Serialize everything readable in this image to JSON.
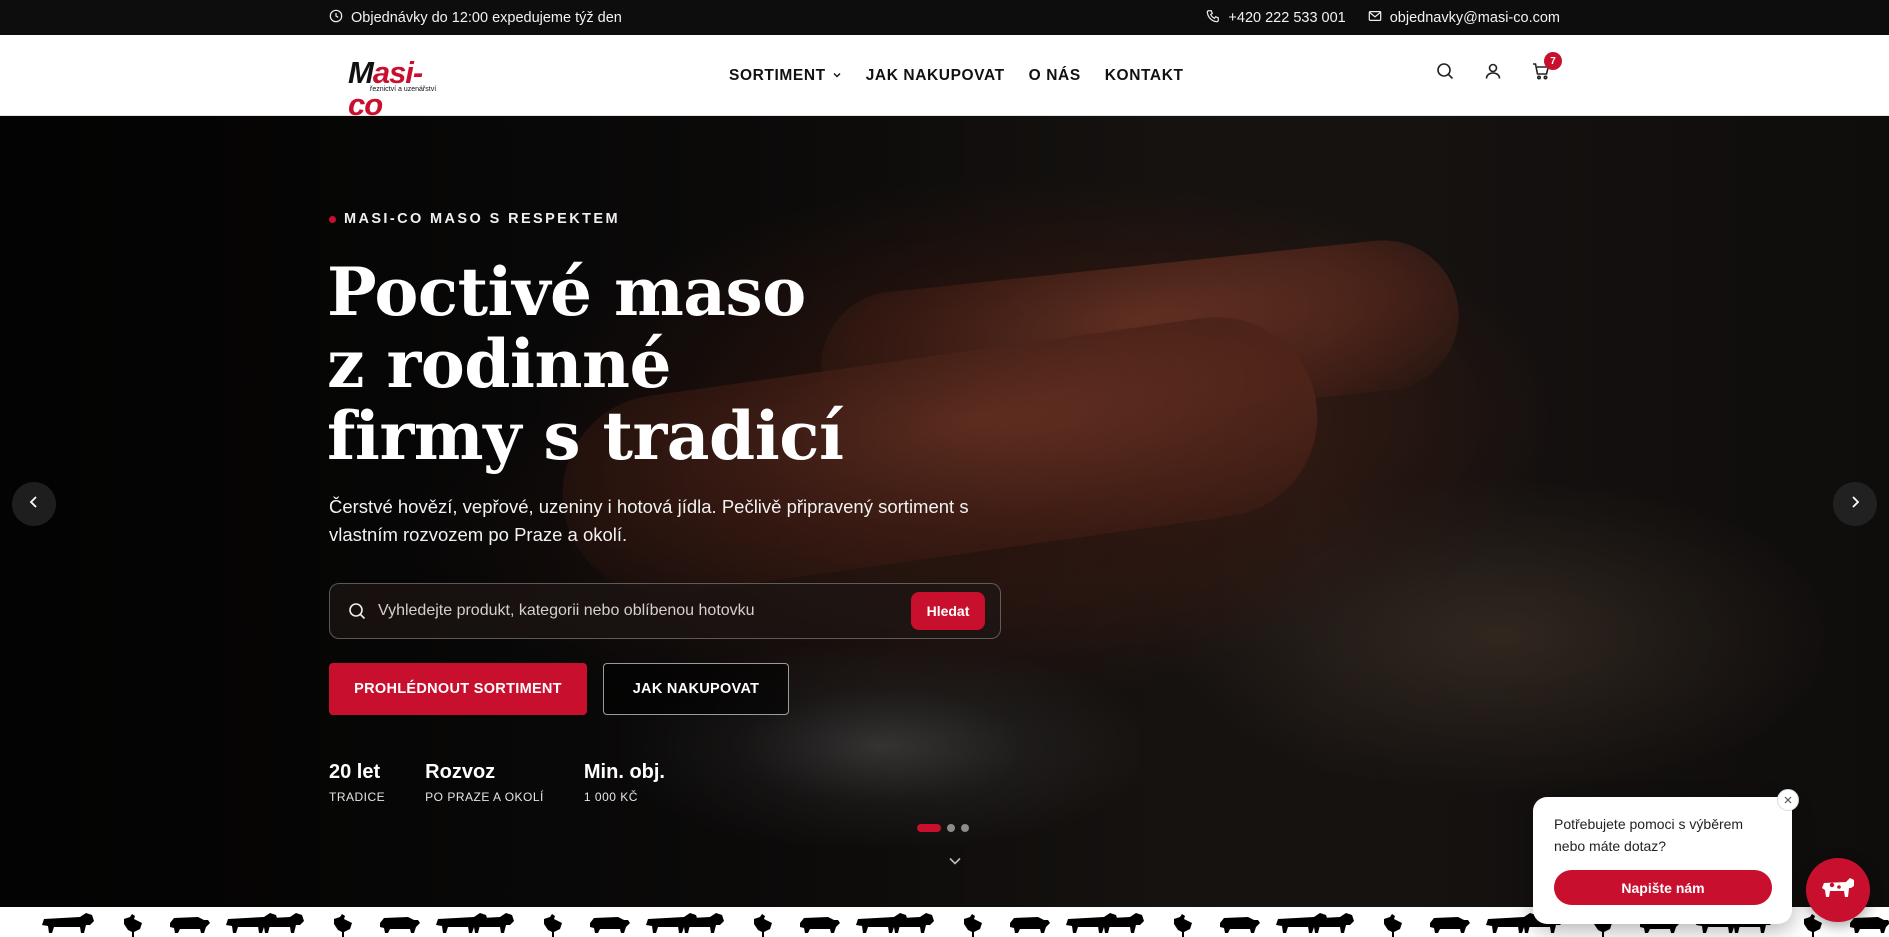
{
  "topbar": {
    "shipping_note": "Objednávky do 12:00 expedujeme týž den",
    "phone": "+420 222 533 001",
    "email": "objednavky@masi-co.com",
    "icons": {
      "clock": "clock-icon",
      "phone": "phone-icon",
      "mail": "mail-icon"
    }
  },
  "header": {
    "logo": {
      "brand_dark": "M",
      "brand_red": "asi-co",
      "tagline": "řeznictví a uzenářství"
    },
    "nav": [
      {
        "label": "SORTIMENT",
        "has_dropdown": true
      },
      {
        "label": "JAK NAKUPOVAT"
      },
      {
        "label": "O NÁS"
      },
      {
        "label": "KONTAKT"
      }
    ],
    "icons": [
      "search-icon",
      "user-icon",
      "cart-icon"
    ],
    "cart_count": "7"
  },
  "hero": {
    "eyebrow": "MASI-CO MASO S RESPEKTEM",
    "title_lines": [
      "Poctivé maso",
      "z rodinné",
      "firmy s tradicí"
    ],
    "lead": "Čerstvé hovězí, vepřové, uzeniny i hotová jídla. Pečlivě připravený sortiment s vlastním rozvozem po Praze a okolí.",
    "search": {
      "placeholder": "Vyhledejte produkt, kategorii nebo oblíbenou hotovku",
      "button": "Hledat"
    },
    "primary_button": "PROHLÉDNOUT SORTIMENT",
    "secondary_button": "JAK NAKUPOVAT",
    "stats": [
      {
        "value": "20 let",
        "label": "TRADICE"
      },
      {
        "value": "Rozvoz",
        "label": "PO PRAZE A OKOLÍ"
      },
      {
        "value": "Min. obj.",
        "label": "1 000 KČ"
      }
    ],
    "slides": {
      "count": 3,
      "active": 1
    }
  },
  "chat": {
    "message": "Potřebujete pomoci s výběrem nebo máte dotaz?",
    "button": "Napište nám"
  },
  "colors": {
    "accent": "#c8102e",
    "topbar_bg": "#0d0d0d",
    "text_dark": "#111111"
  }
}
